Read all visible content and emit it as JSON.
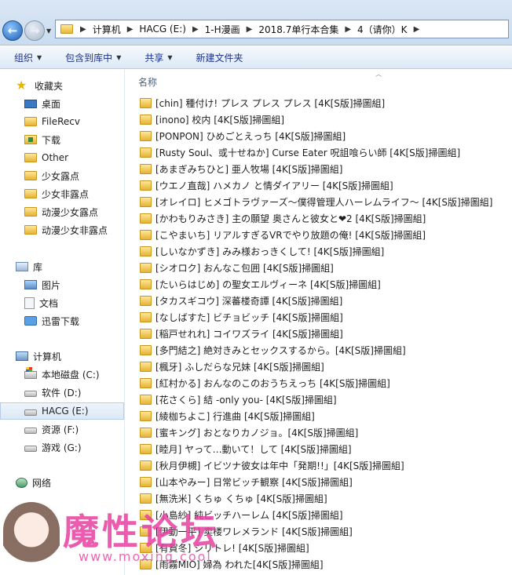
{
  "address": {
    "crumbs": [
      "计算机",
      "HACG (E:)",
      "1-H漫画",
      "2018.7单行本合集",
      "4（请你）K"
    ]
  },
  "toolbar": {
    "organize": "组织",
    "include_library": "包含到库中",
    "share": "共享",
    "new_folder": "新建文件夹"
  },
  "nav": {
    "favorites": "收藏夹",
    "desktop": "桌面",
    "filerecv": "FileRecv",
    "downloads": "下载",
    "other": "Other",
    "fav1": "少女露点",
    "fav2": "少女非露点",
    "fav3": "动漫少女露点",
    "fav4": "动漫少女非露点",
    "library": "库",
    "pictures": "图片",
    "documents": "文档",
    "thunder": "迅雷下载",
    "computer": "计算机",
    "drive_c": "本地磁盘 (C:)",
    "drive_d": "软件 (D:)",
    "drive_e": "HACG (E:)",
    "drive_f": "资源 (F:)",
    "drive_g": "游戏 (G:)",
    "network": "网络"
  },
  "content": {
    "column_name": "名称",
    "files": [
      "[chin] 種付け! プレス プレス プレス [4K[S版]掃圖組]",
      "[inono] 校内 [4K[S版]掃圖組]",
      "[PONPON] ひめごとえっち [4K[S版]掃圖組]",
      "[Rusty Soul、或十せねか] Curse Eater 呪詛喰らい師 [4K[S版]掃圖組]",
      "[あまぎみちひと] 亜人牧場 [4K[S版]掃圖組]",
      "[ウエノ直哉] ハメカノ と情ダイアリー [4K[S版]掃圖組]",
      "[オレイロ] ヒメゴトラヴァーズ～僕得管理人ハーレムライフ～ [4K[S版]掃圖組]",
      "[かわもりみさき] 主の願望 奥さんと彼女と❤2 [4K[S版]掃圖組]",
      "[こやまいち] リアルすぎるVRでやり放題の俺! [4K[S版]掃圖組]",
      "[しいなかずき] みみ様おっきくして! [4K[S版]掃圖組]",
      "[シオロク] おんなこ包囲 [4K[S版]掃圖組]",
      "[たいらはじめ] の聖女エルヴィーネ [4K[S版]掃圖組]",
      "[タカスギコウ] 深蕃楼奇譚 [4K[S版]掃圖組]",
      "[なしばすた] ビチョビッチ [4K[S版]掃圖組]",
      "[稲戸せれれ] コイワズライ [4K[S版]掃圖組]",
      "[多門結之] 絶対きみとセックスするから。[4K[S版]掃圖組]",
      "[楓牙] ふしだらな兄妹 [4K[S版]掃圖組]",
      "[紅村かる] おんなのこのおうちえっち [4K[S版]掃圖組]",
      "[花さくら] 結 -only you- [4K[S版]掃圖組]",
      "[綾枷ちよこ] 行進曲 [4K[S版]掃圖組]",
      "[蜜キング] おとなりカノジョ。[4K[S版]掃圖組]",
      "[睦月] ヤって…動いて！して [4K[S版]掃圖組]",
      "[秋月伊槻] イビツナ彼女は年中「発期!!」[4K[S版]掃圖組]",
      "[山本やみー] 日常ビッチ観察 [4K[S版]掃圖組]",
      "[無洗米] くちゅ くちゅ [4K[S版]掃圖組]",
      "[小島紗] 純ビッチハーレム [4K[S版]掃圖組]",
      "[伊動一平] 卖楼ワレメランド [4K[S版]掃圖組]",
      "[有賀冬] シリトレ! [4K[S版]掃圖組]",
      "[雨霧MIO] 婦為 われた[4K[S版]掃圖組]"
    ]
  },
  "watermark": {
    "title": "魔性论坛",
    "url": "www.moxing.cool"
  },
  "colors": {
    "address_bg": "#c9dcf0",
    "toolbar_text": "#1e3287",
    "selected_bg": "#dce8f5",
    "folder_yellow": "#e6b333",
    "watermark_pink": "#e840a0"
  }
}
